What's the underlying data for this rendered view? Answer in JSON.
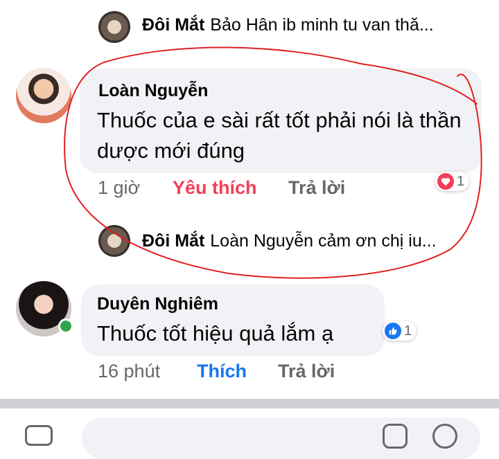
{
  "comments": [
    {
      "replies": [
        {
          "author": "Đôi Mắt",
          "text": "Bảo Hân ib minh tu van thă..."
        }
      ]
    },
    {
      "author": "Loàn Nguyễn",
      "text": "Thuốc của e sài rất tốt phải nói là thần dược mới đúng",
      "time": "1 giờ",
      "reaction_label": "Yêu thích",
      "reply_label": "Trả lời",
      "reaction_icon": "heart-icon",
      "reaction_color": "#f33e58",
      "reaction_count": "1",
      "replies": [
        {
          "author": "Đôi Mắt",
          "text": "Loàn Nguyễn cảm ơn chị iu..."
        }
      ]
    },
    {
      "author": "Duyên Nghiêm",
      "text": "Thuốc tốt hiệu quả lắm ạ",
      "time": "16 phút",
      "reaction_label": "Thích",
      "reply_label": "Trả lời",
      "reaction_icon": "like-icon",
      "reaction_color": "#1877f2",
      "reaction_count": "1",
      "online": true
    }
  ],
  "colors": {
    "love_text": "#f33e58",
    "like_text": "#1877f2",
    "annotation_circle": "#e02020",
    "bubble": "#f0f2f5",
    "meta": "#65676b"
  },
  "composer": {
    "icons": [
      "camera-icon",
      "emoji-icon",
      "gif-icon",
      "sticker-icon"
    ]
  }
}
